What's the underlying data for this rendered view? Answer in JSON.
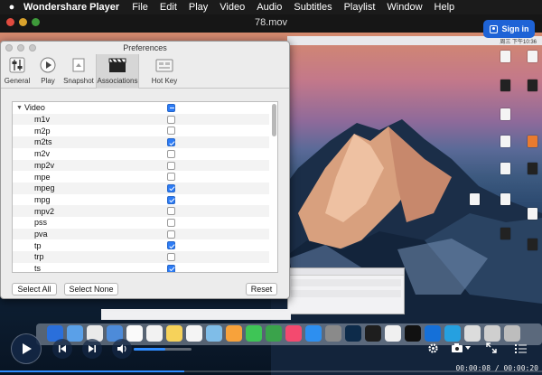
{
  "menubar": {
    "app_name": "Wondershare Player",
    "items": [
      "File",
      "Edit",
      "Play",
      "Video",
      "Audio",
      "Subtitles",
      "Playlist",
      "Window",
      "Help"
    ],
    "clock": "周三 下午10:36"
  },
  "player": {
    "title": "78.mov",
    "sign_in_label": "Sign in",
    "time_elapsed": "00:00:08",
    "time_total": "00:00:20",
    "time_separator": " / ",
    "progress_fraction": 0.34,
    "volume_fraction": 0.55
  },
  "preferences": {
    "title": "Preferences",
    "toolbar": [
      {
        "label": "General",
        "icon": "switches-icon",
        "selected": false
      },
      {
        "label": "Play",
        "icon": "play-circle-icon",
        "selected": false
      },
      {
        "label": "Snapshot",
        "icon": "camera-icon",
        "selected": false
      },
      {
        "label": "Associations",
        "icon": "clapperboard-icon",
        "selected": true
      },
      {
        "label": "Hot Key",
        "icon": "keyboard-icon",
        "selected": false
      }
    ],
    "group_label": "Video",
    "group_state": "mixed",
    "formats": [
      {
        "name": "m1v",
        "checked": false
      },
      {
        "name": "m2p",
        "checked": false
      },
      {
        "name": "m2ts",
        "checked": true
      },
      {
        "name": "m2v",
        "checked": false
      },
      {
        "name": "mp2v",
        "checked": false
      },
      {
        "name": "mpe",
        "checked": false
      },
      {
        "name": "mpeg",
        "checked": true
      },
      {
        "name": "mpg",
        "checked": true
      },
      {
        "name": "mpv2",
        "checked": false
      },
      {
        "name": "pss",
        "checked": false
      },
      {
        "name": "pva",
        "checked": false
      },
      {
        "name": "tp",
        "checked": true
      },
      {
        "name": "trp",
        "checked": false
      },
      {
        "name": "ts",
        "checked": true
      }
    ],
    "select_all_label": "Select All",
    "select_none_label": "Select None",
    "reset_label": "Reset"
  },
  "colors": {
    "accent": "#2d7cf6",
    "sign_in_bg": "#1e63d6"
  }
}
